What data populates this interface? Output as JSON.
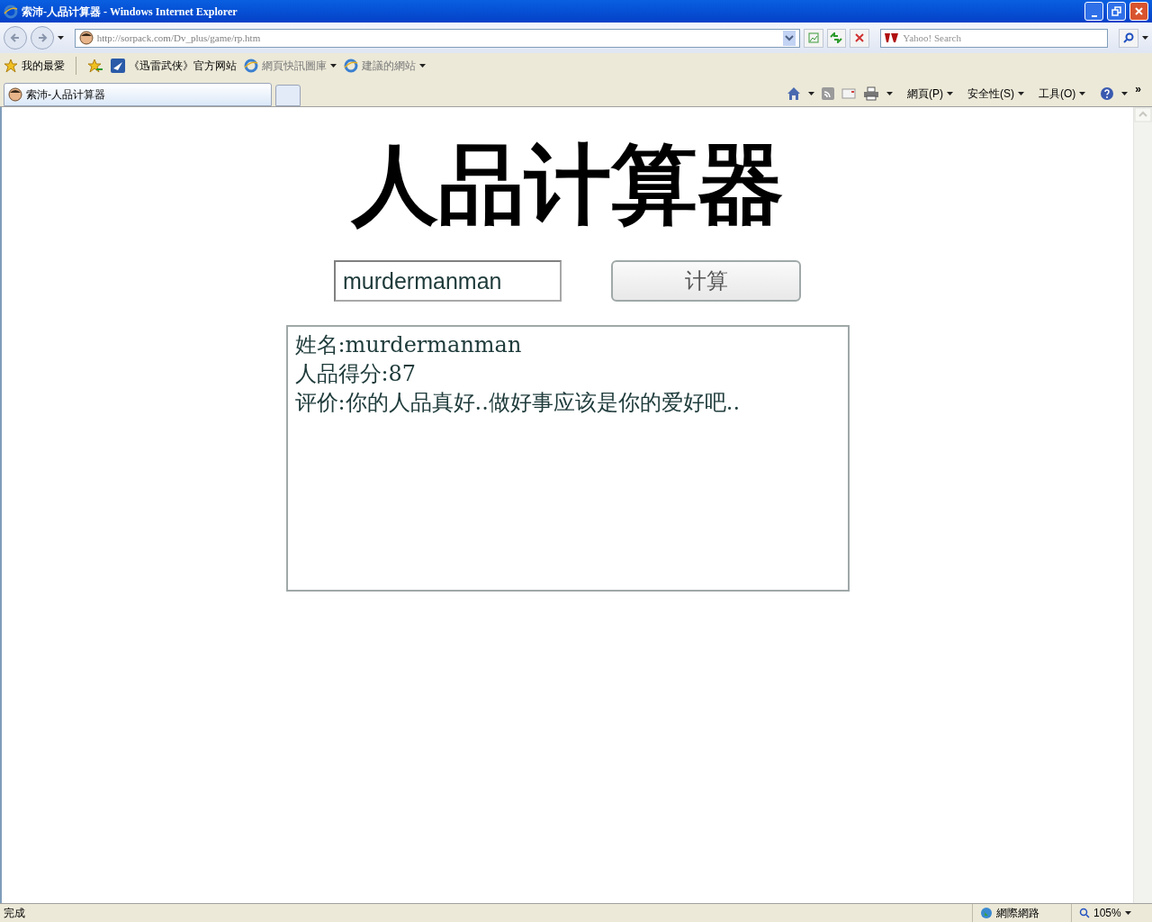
{
  "window": {
    "title": "索沛-人品计算器 - Windows Internet Explorer"
  },
  "address_bar": {
    "url": "http://sorpack.com/Dv_plus/game/rp.htm"
  },
  "search": {
    "placeholder": "Yahoo! Search"
  },
  "favorites_bar": {
    "label": "我的最愛",
    "items": [
      {
        "kind": "link",
        "label": "《迅雷武侠》官方网站",
        "dimmed": false
      },
      {
        "kind": "menu",
        "label": "網頁快訊圖庫",
        "dimmed": true
      },
      {
        "kind": "menu",
        "label": "建議的網站",
        "dimmed": true
      }
    ]
  },
  "tabs": [
    {
      "label": "索沛-人品计算器",
      "selected": true
    }
  ],
  "command_bar": {
    "menus": [
      "網頁(P)",
      "安全性(S)",
      "工具(O)"
    ],
    "overflow": "»"
  },
  "page": {
    "heading": "人品计算器",
    "name_input": {
      "value": "murdermanman"
    },
    "calc_button": "计算",
    "result_lines": [
      "姓名:murdermanman",
      "人品得分:87",
      "评价:你的人品真好..做好事应该是你的爱好吧.."
    ]
  },
  "status_bar": {
    "text": "完成",
    "zone": "網際網路",
    "zoom": "105%"
  }
}
